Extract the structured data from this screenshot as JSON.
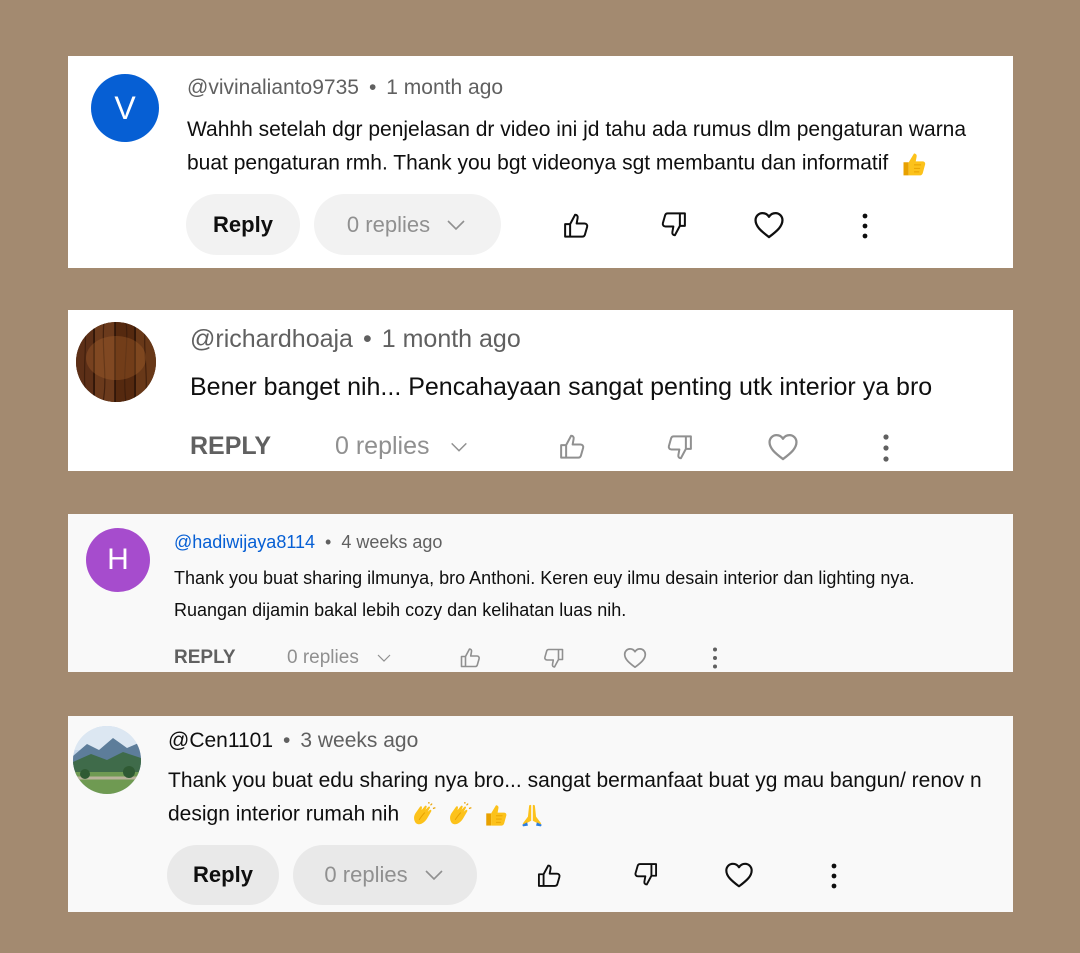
{
  "comments": [
    {
      "avatar_letter": "V",
      "avatar_color": "#065fd4",
      "handle": "@vivinalianto9735",
      "separator": "•",
      "time": "1 month ago",
      "text_line1": "Wahhh setelah dgr penjelasan dr video ini jd tahu ada rumus dlm pengaturan warna",
      "text_line2": "buat pengaturan rmh. Thank you bgt videonya sgt membantu dan informatif",
      "emojis": [
        "thumbs-up"
      ],
      "reply_label": "Reply",
      "replies_label": "0 replies"
    },
    {
      "avatar_type": "wood-texture",
      "handle": "@richardhoaja",
      "separator": "•",
      "time": "1 month ago",
      "text_line1": "Bener banget nih... Pencahayaan sangat penting utk interior ya bro",
      "reply_label": "REPLY",
      "replies_label": "0 replies"
    },
    {
      "avatar_letter": "H",
      "avatar_color": "#a64ccd",
      "handle": "@hadiwijaya8114",
      "handle_color": "#065fd4",
      "separator": "•",
      "time": "4 weeks ago",
      "text_line1": "Thank you buat sharing ilmunya, bro Anthoni. Keren euy ilmu desain interior dan lighting nya.",
      "text_line2": "Ruangan dijamin bakal lebih cozy dan kelihatan luas nih.",
      "reply_label": "REPLY",
      "replies_label": "0 replies"
    },
    {
      "avatar_type": "mountain-photo",
      "handle": "@Cen1101",
      "separator": "•",
      "time": "3 weeks ago",
      "text_line1": "Thank you buat edu sharing nya bro... sangat bermanfaat buat yg mau bangun/ renov n",
      "text_line2": "design interior rumah nih",
      "emojis": [
        "clapping-hands",
        "clapping-hands",
        "thumbs-up",
        "folded-hands"
      ],
      "reply_label": "Reply",
      "replies_label": "0 replies"
    }
  ]
}
